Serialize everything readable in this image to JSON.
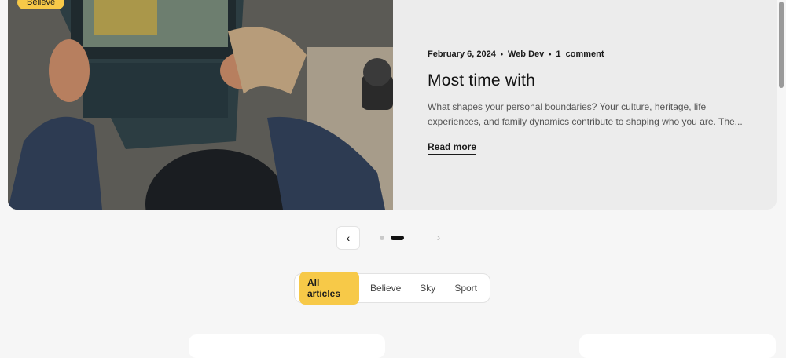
{
  "featured": {
    "badge": "Believe",
    "date": "February 6, 2024",
    "separator": "•",
    "category": "Web Dev",
    "comments": "1  comment",
    "title": "Most time with",
    "excerpt": "What shapes your personal boundaries? Your culture, heritage, life experiences, and family dynamics contribute to shaping who you are. The...",
    "read_more": "Read more"
  },
  "pager": {
    "prev_icon": "‹",
    "next_icon": "›"
  },
  "filters": {
    "tabs": [
      "All articles",
      "Believe",
      "Sky",
      "Sport"
    ],
    "active": "All articles"
  },
  "colors": {
    "accent": "#f7c948",
    "background": "#f6f6f6"
  }
}
